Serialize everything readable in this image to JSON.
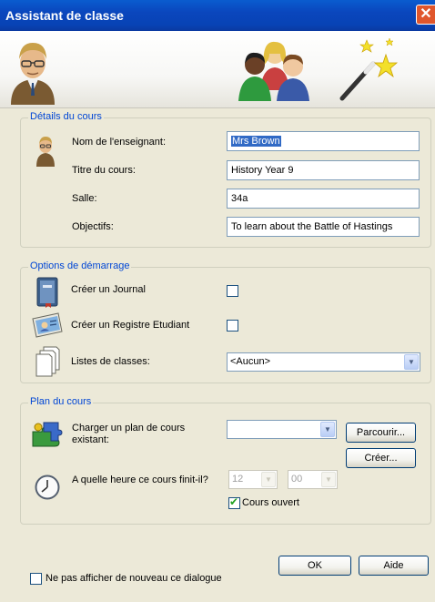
{
  "window": {
    "title": "Assistant de classe",
    "close_glyph": "✕"
  },
  "header_icons": [
    "teacher-icon",
    "students-icon",
    "magic-wand-icon"
  ],
  "course_details": {
    "group_title": "Détails du cours",
    "teacher_label": "Nom de l'enseignant:",
    "teacher_value": "Mrs Brown",
    "course_title_label": "Titre du cours:",
    "course_title_value": "History Year 9",
    "room_label": "Salle:",
    "room_value": "34a",
    "objectives_label": "Objectifs:",
    "objectives_value": "To learn about the Battle of Hastings"
  },
  "startup_options": {
    "group_title": "Options de démarrage",
    "journal_label": "Créer un Journal",
    "journal_checked": false,
    "register_label": "Créer un Registre Etudiant",
    "register_checked": false,
    "class_lists_label": "Listes de classes:",
    "class_lists_value": "<Aucun>"
  },
  "lesson_plan": {
    "group_title": "Plan du cours",
    "load_label": "Charger un plan de cours existant:",
    "load_value": "",
    "browse_button": "Parcourir...",
    "create_button": "Créer...",
    "end_time_label": "A quelle heure ce cours finit-il?",
    "hour_value": "12",
    "minute_value": "00",
    "open_course_label": "Cours ouvert",
    "open_course_checked": true
  },
  "footer": {
    "ok_button": "OK",
    "help_button": "Aide",
    "dont_show_label": "Ne pas afficher de nouveau ce dialogue",
    "dont_show_checked": false
  },
  "colors": {
    "title_bar": "#0a46bd",
    "group_title": "#0046d5",
    "selection": "#316ac5",
    "close_button": "#e0562c"
  }
}
